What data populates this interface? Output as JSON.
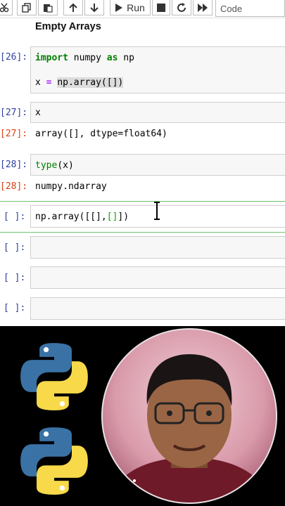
{
  "toolbar": {
    "run_label": "Run",
    "cell_type": "Code",
    "icons": [
      "cut-icon",
      "copy-icon",
      "paste-icon",
      "move-up-icon",
      "move-down-icon",
      "run-icon",
      "stop-icon",
      "restart-icon",
      "fast-forward-icon"
    ]
  },
  "notebook": {
    "heading": "Empty Arrays",
    "cells": [
      {
        "prompt_in": "[26]:",
        "code_lines": [
          "import numpy as np",
          "x = np.array([])"
        ]
      },
      {
        "prompt_in": "[27]:",
        "code": "x",
        "prompt_out": "[27]:",
        "output": "array([], dtype=float64)"
      },
      {
        "prompt_in": "[28]:",
        "code": "type(x)",
        "prompt_out": "[28]:",
        "output": "numpy.ndarray"
      },
      {
        "prompt_in": "[ ]:",
        "code": "np.array([[],[]])"
      },
      {
        "prompt_in": "[ ]:",
        "code": ""
      },
      {
        "prompt_in": "[ ]:",
        "code": ""
      },
      {
        "prompt_in": "[ ]:",
        "code": ""
      }
    ]
  },
  "colors": {
    "prompt_in": "#303f9f",
    "prompt_out": "#d84315",
    "keyword": "#008000",
    "selected_border": "#6ec46e",
    "python_blue": "#3a72a6",
    "python_yellow": "#f7d94a"
  }
}
